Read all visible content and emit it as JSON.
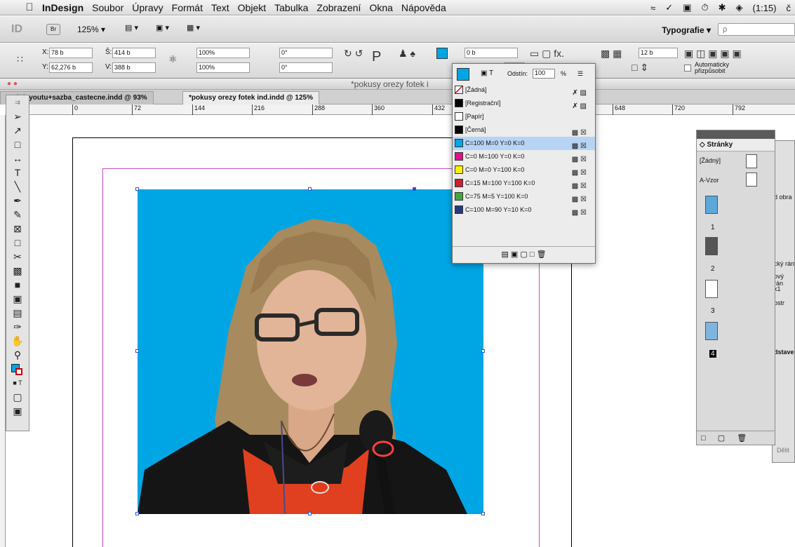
{
  "menubar": {
    "items": [
      "InDesign",
      "Soubor",
      "Úpravy",
      "Formát",
      "Text",
      "Objekt",
      "Tabulka",
      "Zobrazení",
      "Okna",
      "Nápověda"
    ],
    "battery": "(1:15)",
    "extra": "č"
  },
  "appbar": {
    "logo": "ID",
    "bridge": "Br",
    "zoom": "125% ▾",
    "workspace": "Typografie ▾",
    "search_placeholder": "ρ"
  },
  "control": {
    "x_label": "X:",
    "x_value": "78 b",
    "y_label": "Y:",
    "y_value": "62,276 b",
    "w_label": "Š:",
    "w_value": "414 b",
    "h_label": "V:",
    "h_value": "388 b",
    "scale_x": "100%",
    "scale_y": "100%",
    "angle": "0°",
    "shear": "0°",
    "stroke": "0 b",
    "opacity_label": "Odstín:",
    "opacity_value": "100",
    "opacity_unit": "%",
    "gap": "12 b",
    "autofit": "Automaticky přizpůsobit"
  },
  "window": {
    "title": "*pokusy orezy fotek i"
  },
  "tabs": [
    {
      "label": "avrh layoutu+sazba_castecne.indd @ 93%"
    },
    {
      "label": "*pokusy orezy fotek ind.indd @ 125%"
    }
  ],
  "ruler": {
    "ticks": [
      "0",
      "72",
      "144",
      "216",
      "288",
      "360",
      "432",
      "648",
      "720",
      "792"
    ]
  },
  "swatches": [
    {
      "name": "[Žádná]",
      "color": "#ffffff",
      "selected": false
    },
    {
      "name": "[Registrační]",
      "color": "#000000",
      "selected": false
    },
    {
      "name": "[Papír]",
      "color": "#ffffff",
      "selected": false
    },
    {
      "name": "[Černá]",
      "color": "#000000",
      "selected": false
    },
    {
      "name": "C=100 M=0 Y=0 K=0",
      "color": "#00a6e4",
      "selected": true
    },
    {
      "name": "C=0 M=100 Y=0 K=0",
      "color": "#e0118a",
      "selected": false
    },
    {
      "name": "C=0 M=0 Y=100 K=0",
      "color": "#fff200",
      "selected": false
    },
    {
      "name": "C=15 M=100 Y=100 K=0",
      "color": "#c8202f",
      "selected": false
    },
    {
      "name": "C=75 M=5 Y=100 K=0",
      "color": "#3faa3a",
      "selected": false
    },
    {
      "name": "C=100 M=90 Y=10 K=0",
      "color": "#26397f",
      "selected": false
    }
  ],
  "pages": {
    "panel_title": "◇ Stránky",
    "none_master": "[Žádný]",
    "a_master": "A-Vzor",
    "page_numbers": [
      "1",
      "2",
      "3",
      "4"
    ]
  },
  "behind_panel": {
    "lines": [
      "d obra",
      "cký rán",
      "ový rán",
      "k1",
      "ostr",
      "dstave",
      "Dělit"
    ]
  }
}
